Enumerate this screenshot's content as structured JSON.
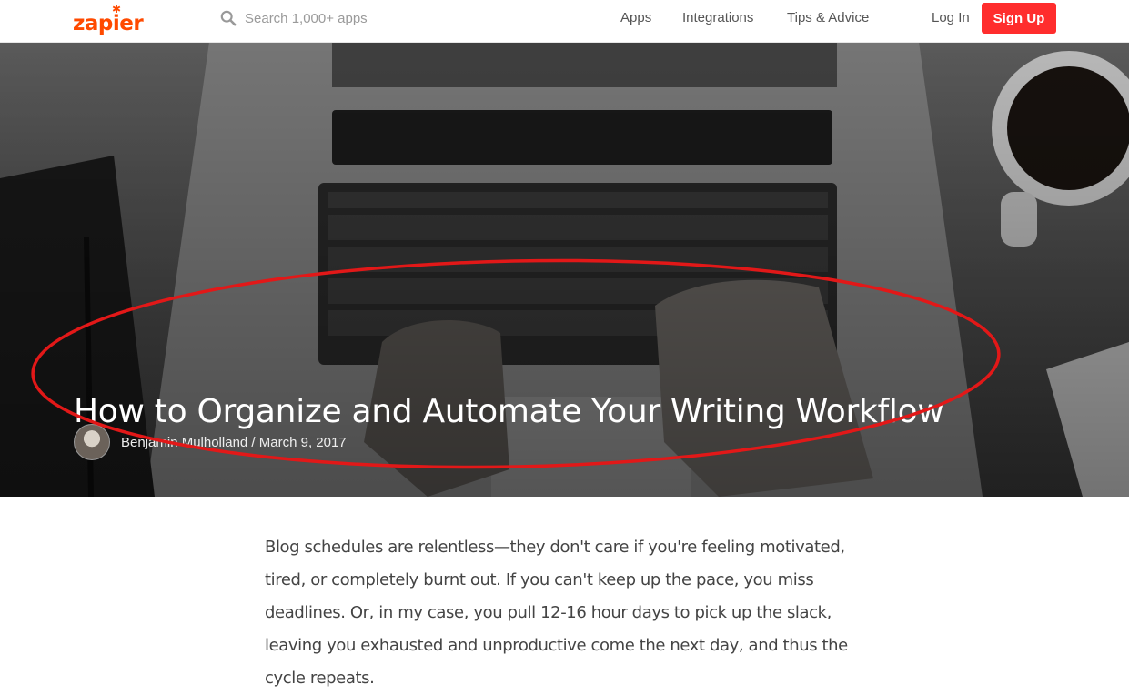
{
  "header": {
    "logo": "zapier",
    "search": {
      "placeholder": "Search 1,000+ apps",
      "icon": "search-icon"
    },
    "nav": [
      "Apps",
      "Integrations",
      "Tips & Advice"
    ],
    "login_label": "Log In",
    "signup_label": "Sign Up"
  },
  "hero": {
    "title": "How to Organize and Automate Your Writing Workflow",
    "author": "Benjamin Mulholland",
    "separator": "/",
    "date": "March 9, 2017",
    "annotation_color": "#e21818"
  },
  "article": {
    "paragraph": "Blog schedules are relentless—they don't care if you're feeling motivated, tired, or completely burnt out. If you can't keep up the pace, you miss deadlines. Or, in my case, you pull 12-16 hour days to pick up the slack, leaving you exhausted and unproductive come the next day, and thus the cycle repeats."
  },
  "colors": {
    "brand": "#ff4a00",
    "signup": "#ff2d2d"
  }
}
